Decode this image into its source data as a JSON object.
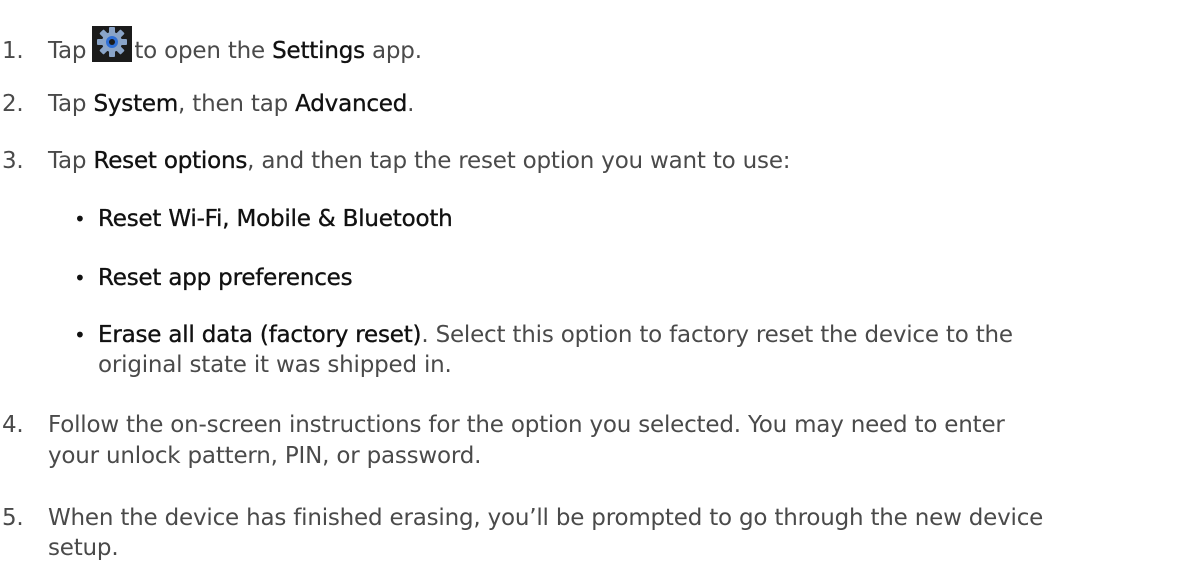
{
  "steps": [
    {
      "number": "1.",
      "prefix": "Tap",
      "icon": "settings-gear-icon",
      "mid": "to open the",
      "bold": "Settings",
      "suffix": "app."
    },
    {
      "number": "2.",
      "prefix": "Tap",
      "bold1": "System",
      "mid": ", then tap",
      "bold2": "Advanced",
      "suffix": "."
    },
    {
      "number": "3.",
      "prefix": "Tap",
      "bold": "Reset options",
      "suffix": ", and then tap the reset option you want to use:",
      "options": [
        {
          "bullet": "•",
          "label": "Reset Wi-Fi, Mobile & Bluetooth"
        },
        {
          "bullet": "•",
          "label": "Reset app preferences"
        },
        {
          "bullet": "•",
          "label": "Erase all data (factory reset)",
          "desc_line1": ". Select this option to factory reset the device to the",
          "desc_line2": "original state it was shipped in."
        }
      ]
    },
    {
      "number": "4.",
      "line1": "Follow the on-screen instructions for the option you selected. You may need to enter",
      "line2": "your unlock pattern, PIN, or password."
    },
    {
      "number": "5.",
      "line1": "When the device has finished erasing, you’ll be prompted to go through the new device",
      "line2": "setup."
    }
  ],
  "colors": {
    "body_text": "#4a4a4a",
    "emphasis_text": "#111111",
    "icon_background": "#1b1b1b",
    "icon_gear": "#8aa4c8",
    "icon_center": "#2f6fd6"
  }
}
